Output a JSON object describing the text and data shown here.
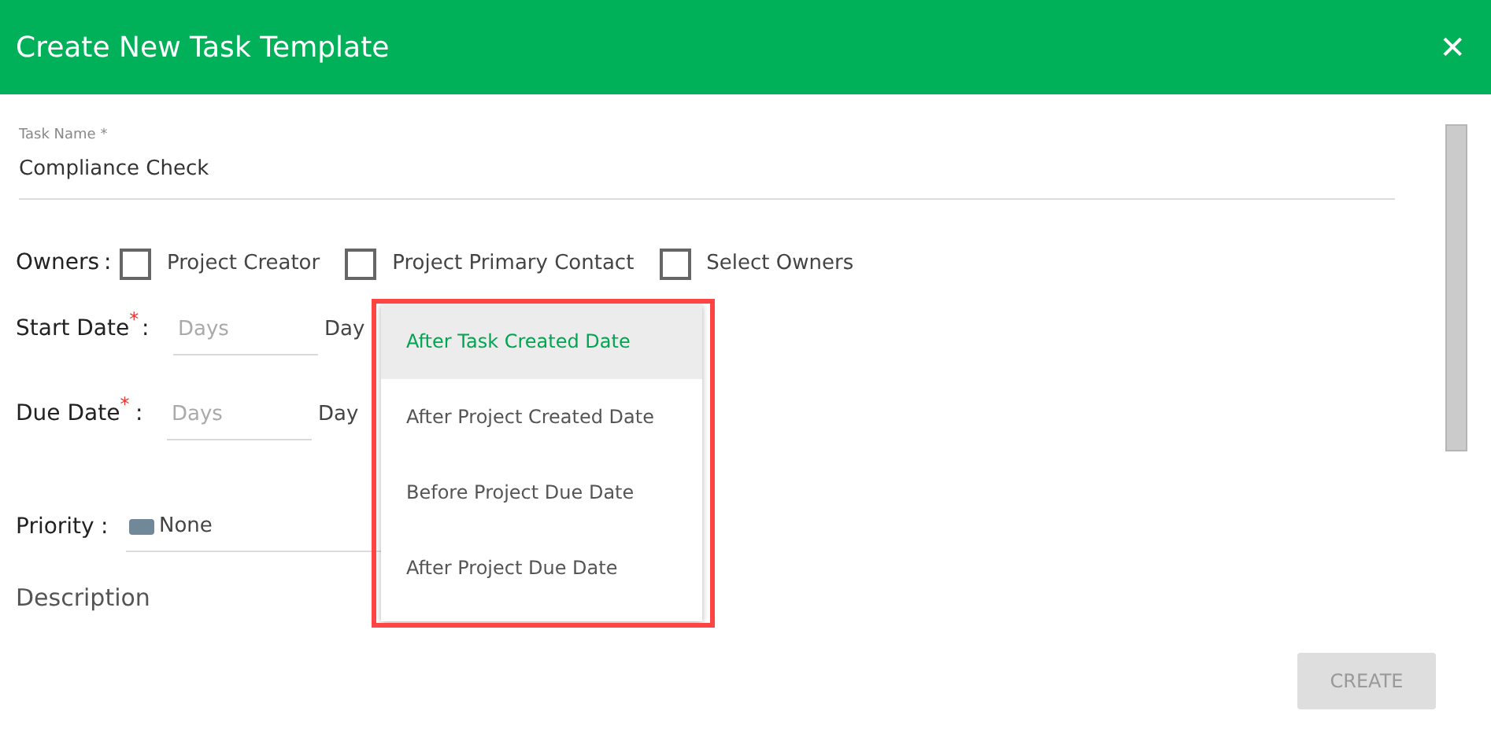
{
  "dialog": {
    "title": "Create New Task Template",
    "close": "✕"
  },
  "task_name": {
    "label": "Task Name *",
    "value": "Compliance Check"
  },
  "owners": {
    "label": "Owners",
    "separator": ":",
    "options": [
      {
        "label": "Project Creator",
        "checked": false
      },
      {
        "label": "Project Primary Contact",
        "checked": false
      },
      {
        "label": "Select Owners",
        "checked": false
      }
    ]
  },
  "start_date": {
    "label": "Start Date",
    "required_mark": "*",
    "separator": ":",
    "placeholder": "Days",
    "unit": "Day"
  },
  "due_date": {
    "label": "Due Date",
    "required_mark": "*",
    "separator": ":",
    "placeholder": "Days",
    "unit": "Day"
  },
  "priority": {
    "label": "Priority",
    "separator": ":",
    "value": "None",
    "color": "#708898"
  },
  "description": {
    "label": "Description"
  },
  "dropdown": {
    "highlighted": true,
    "items": [
      {
        "label": "After Task Created Date",
        "selected": true
      },
      {
        "label": "After Project Created Date",
        "selected": false
      },
      {
        "label": "Before Project Due Date",
        "selected": false
      },
      {
        "label": "After Project Due Date",
        "selected": false
      }
    ]
  },
  "create_button": {
    "label": "CREATE",
    "disabled": true
  }
}
